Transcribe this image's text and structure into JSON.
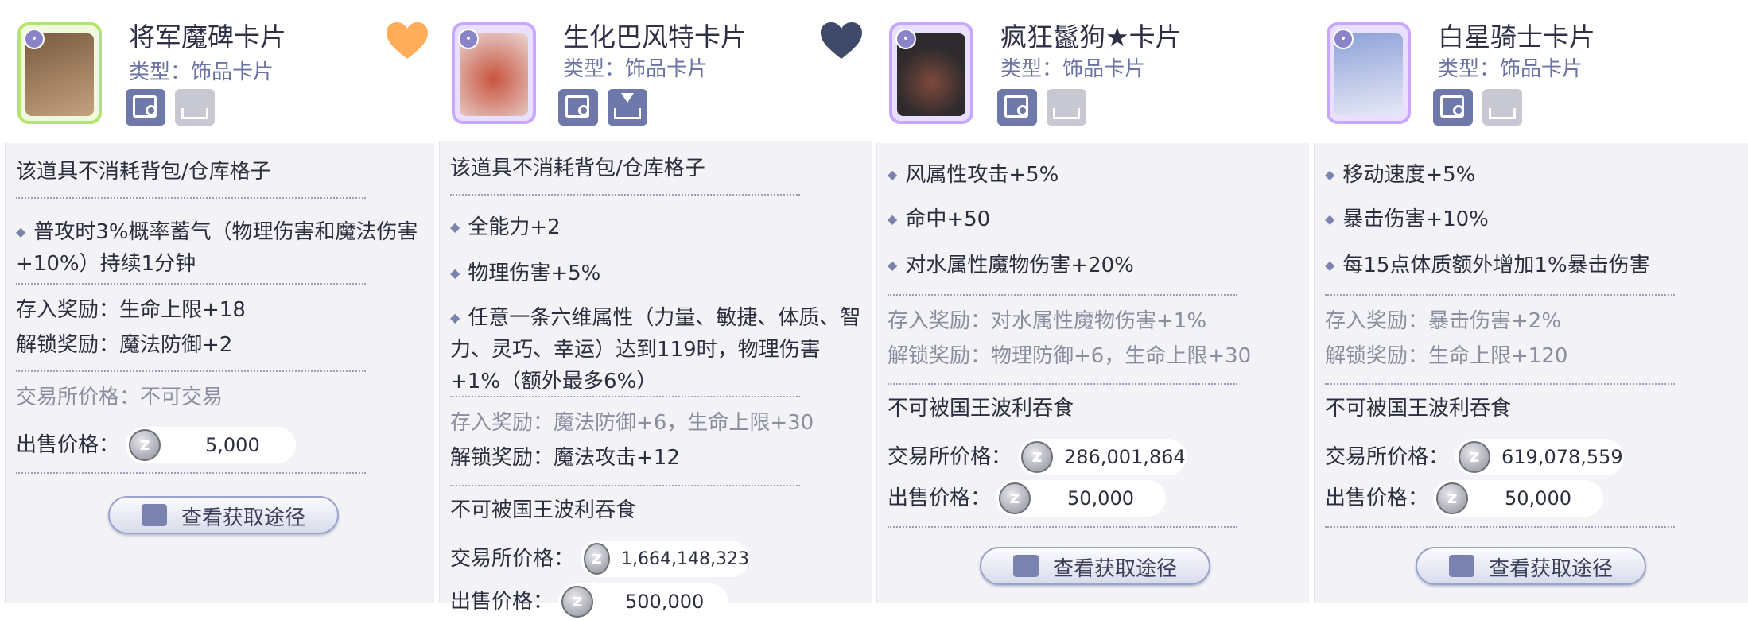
{
  "cards": [
    {
      "title": "将军魔碑卡片",
      "type": "类型：饰品卡片",
      "favorite": true,
      "heart_color": "#ffad5a",
      "portrait_colors": [
        "#7a5a3e",
        "#c2a27f"
      ],
      "no_bag": "该道具不消耗背包/仓库格子",
      "effects": [
        "普攻时3%概率蓄气（物理伤害和魔法伤害+10%）持续1分钟"
      ],
      "deposit_reward": "存入奖励：生命上限+18",
      "unlock_reward": "解锁奖励：魔法防御+2",
      "trade_price": "交易所价格：不可交易",
      "sell_label": "出售价格：",
      "sell_price": "5,000",
      "source_button": "查看获取途径"
    },
    {
      "title": "生化巴风特卡片",
      "type": "类型：饰品卡片",
      "favorite": false,
      "heart_color": "#3f4a6a",
      "portrait_colors": [
        "#c8543e",
        "#e9d6d2"
      ],
      "no_bag": "该道具不消耗背包/仓库格子",
      "effects": [
        "全能力+2",
        "物理伤害+5%",
        "任意一条六维属性（力量、敏捷、体质、智力、灵巧、幸运）达到119时，物理伤害+1%（额外最多6%）"
      ],
      "deposit_reward": "存入奖励：魔法防御+6，生命上限+30",
      "unlock_reward": "解锁奖励：魔法攻击+12",
      "not_devour": "不可被国王波利吞食",
      "trade_label": "交易所价格：",
      "trade_price": "1,664,148,323",
      "sell_label": "出售价格：",
      "sell_price": "500,000"
    },
    {
      "title": "疯狂鬣狗★卡片",
      "type": "类型：饰品卡片",
      "portrait_colors": [
        "#2e2a2d",
        "#7d4a3c"
      ],
      "effects": [
        "风属性攻击+5%",
        "命中+50",
        "对水属性魔物伤害+20%"
      ],
      "deposit_reward": "存入奖励：对水属性魔物伤害+1%",
      "unlock_reward": "解锁奖励：物理防御+6，生命上限+30",
      "not_devour": "不可被国王波利吞食",
      "trade_label": "交易所价格：",
      "trade_price": "286,001,864",
      "sell_label": "出售价格：",
      "sell_price": "50,000",
      "source_button": "查看获取途径"
    },
    {
      "title": "白星骑士卡片",
      "type": "类型：饰品卡片",
      "portrait_colors": [
        "#8fa2d8",
        "#e6e9f6"
      ],
      "effects": [
        "移动速度+5%",
        "暴击伤害+10%",
        "每15点体质额外增加1%暴击伤害"
      ],
      "deposit_reward": "存入奖励：暴击伤害+2%",
      "unlock_reward": "解锁奖励：生命上限+120",
      "not_devour": "不可被国王波利吞食",
      "trade_label": "交易所价格：",
      "trade_price": "619,078,559",
      "sell_label": "出售价格：",
      "sell_price": "50,000",
      "source_button": "查看获取途径"
    }
  ]
}
